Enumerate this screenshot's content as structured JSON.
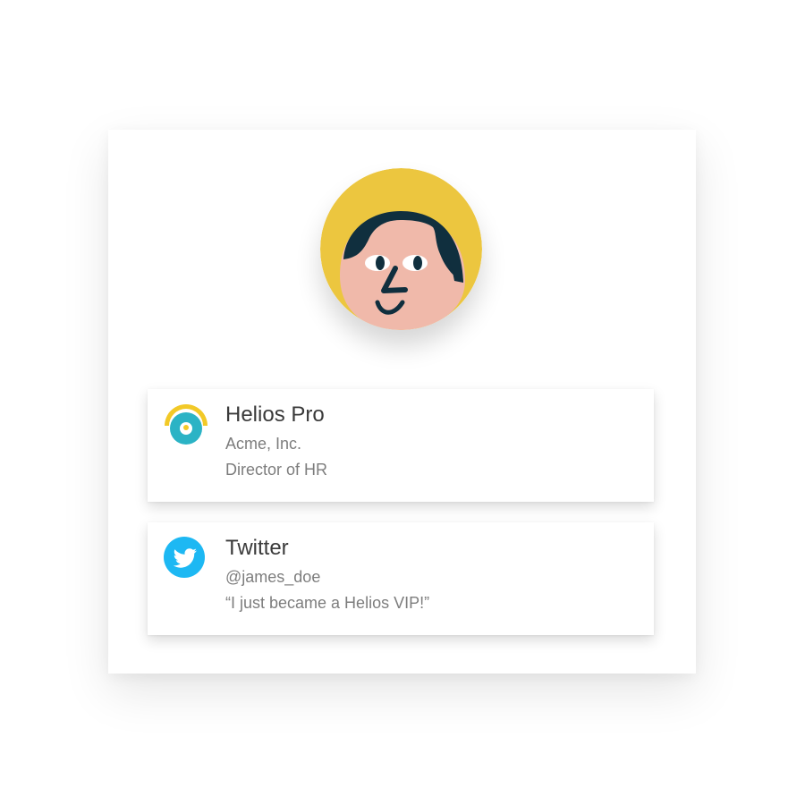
{
  "avatar": {
    "icon": "cartoon-face-avatar",
    "background_color": "#ECC63F",
    "skin_color": "#F0B9AA",
    "hair_color": "#102F3E"
  },
  "cards": [
    {
      "icon": "helios-logo-icon",
      "title": "Helios Pro",
      "line1": "Acme, Inc.",
      "line2": "Director of HR"
    },
    {
      "icon": "twitter-bird-icon",
      "title": "Twitter",
      "line1": "@james_doe",
      "line2": "“I just became a Helios VIP!”"
    }
  ],
  "colors": {
    "text_primary": "#3A3A3A",
    "text_secondary": "#7D7D7D",
    "twitter_blue": "#1DB8F3",
    "helios_teal": "#2BB3C5",
    "helios_yellow": "#F2C927"
  }
}
